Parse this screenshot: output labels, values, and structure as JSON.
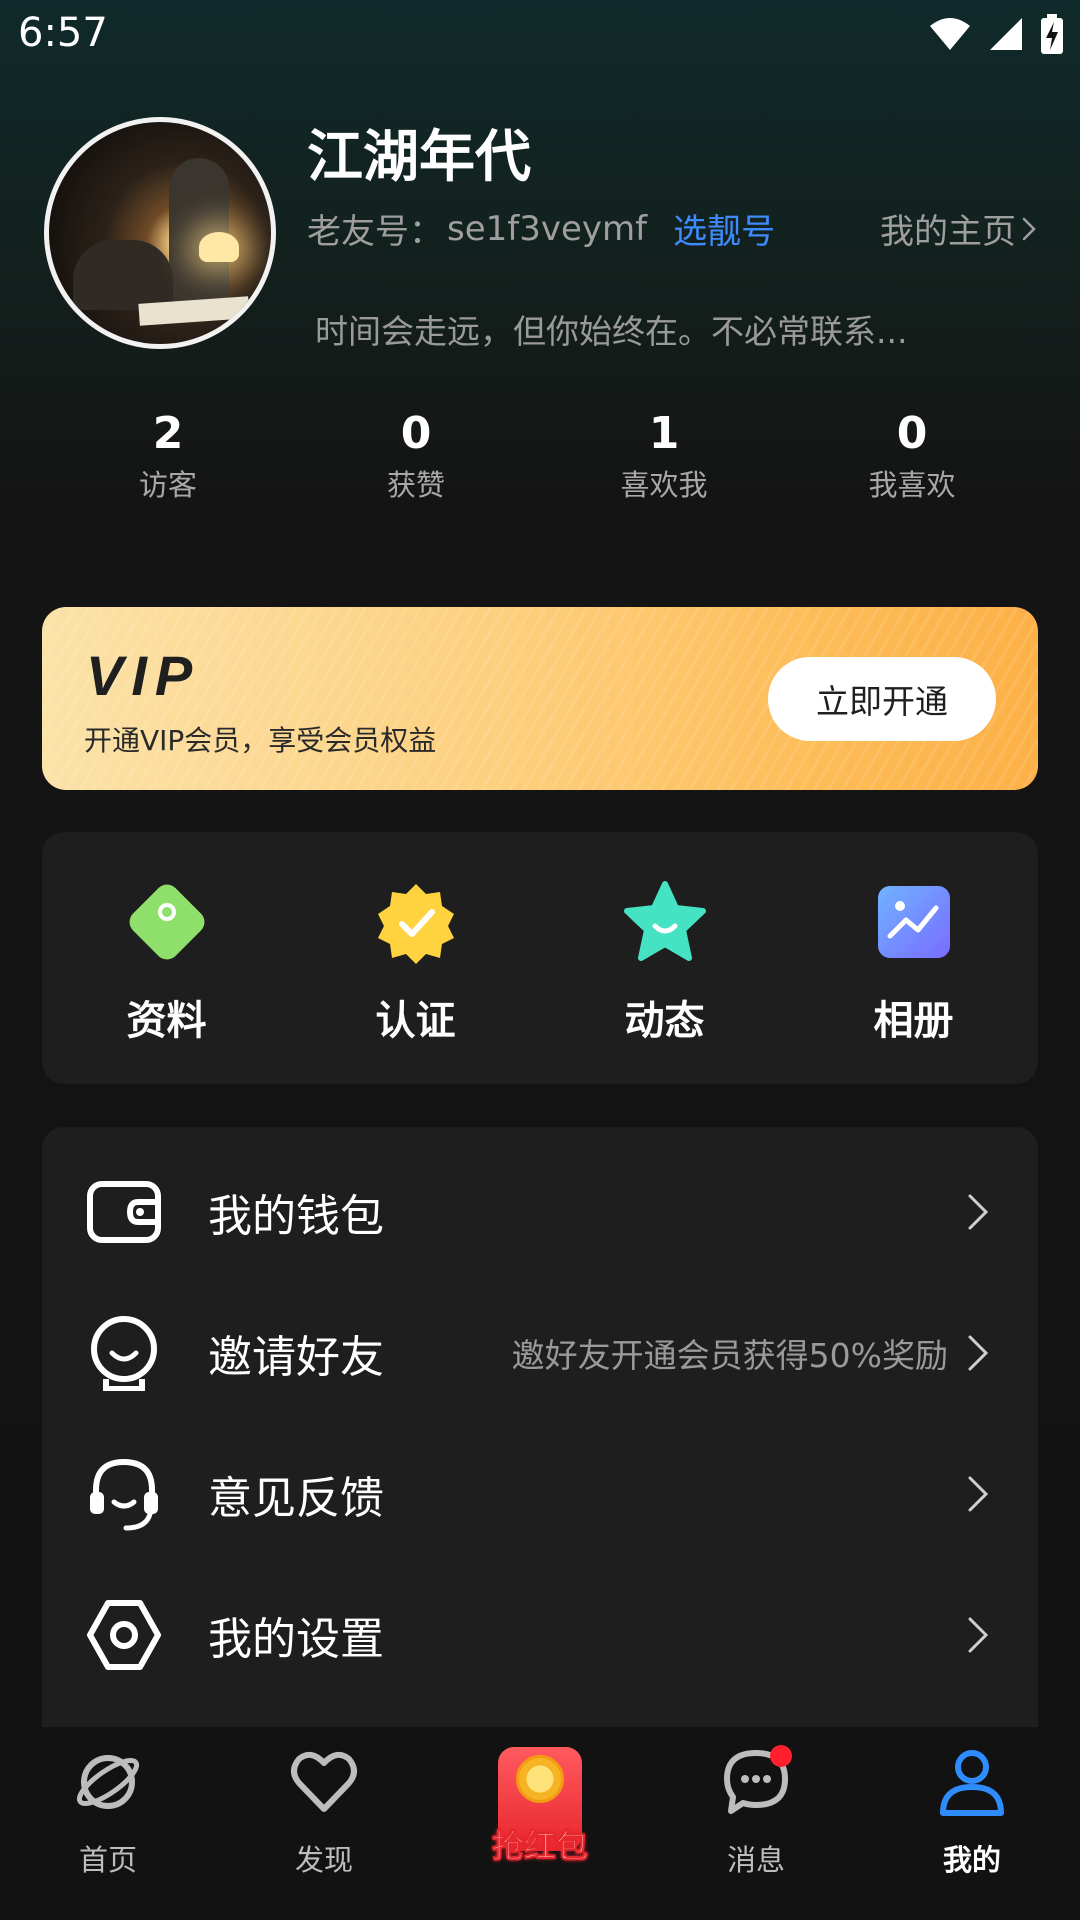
{
  "status_bar": {
    "time": "6:57"
  },
  "profile": {
    "nickname": "江湖年代",
    "friend_id_label": "老友号：",
    "friend_id": "se1f3veymf",
    "choose_number": "选靓号",
    "homepage_link": "我的主页",
    "signature": "时间会走远，但你始终在。不必常联系..."
  },
  "stats": [
    {
      "value": "2",
      "label": "访客"
    },
    {
      "value": "0",
      "label": "获赞"
    },
    {
      "value": "1",
      "label": "喜欢我"
    },
    {
      "value": "0",
      "label": "我喜欢"
    }
  ],
  "vip": {
    "logo": "VIP",
    "description": "开通VIP会员，享受会员权益",
    "button": "立即开通"
  },
  "quick_actions": [
    {
      "label": "资料",
      "icon": "tag-icon",
      "color": "#8ee06a"
    },
    {
      "label": "认证",
      "icon": "verified-badge-icon",
      "color": "#ffd23f"
    },
    {
      "label": "动态",
      "icon": "star-smile-icon",
      "color": "#45e3c4"
    },
    {
      "label": "相册",
      "icon": "photo-chart-icon",
      "color": "#7d9cff"
    }
  ],
  "menu": [
    {
      "label": "我的钱包",
      "hint": "",
      "icon": "wallet-icon"
    },
    {
      "label": "邀请好友",
      "hint": "邀好友开通会员获得50%奖励",
      "icon": "invite-friend-icon"
    },
    {
      "label": "意见反馈",
      "hint": "",
      "icon": "headset-icon"
    },
    {
      "label": "我的设置",
      "hint": "",
      "icon": "settings-icon"
    }
  ],
  "tabs": [
    {
      "label": "首页",
      "icon": "planet-icon",
      "active": false
    },
    {
      "label": "发现",
      "icon": "heart-icon",
      "active": false
    },
    {
      "label": "抢红包",
      "icon": "red-packet-icon",
      "active": false
    },
    {
      "label": "消息",
      "icon": "chat-bubble-icon",
      "active": false,
      "badge": true
    },
    {
      "label": "我的",
      "icon": "person-icon",
      "active": true
    }
  ],
  "colors": {
    "accent_blue": "#3d8bff",
    "vip_gold": "#fdbb55",
    "card_bg": "#1e1e1e",
    "active_tab_blue": "#2f8cff",
    "badge_red": "#ff1f2d"
  }
}
